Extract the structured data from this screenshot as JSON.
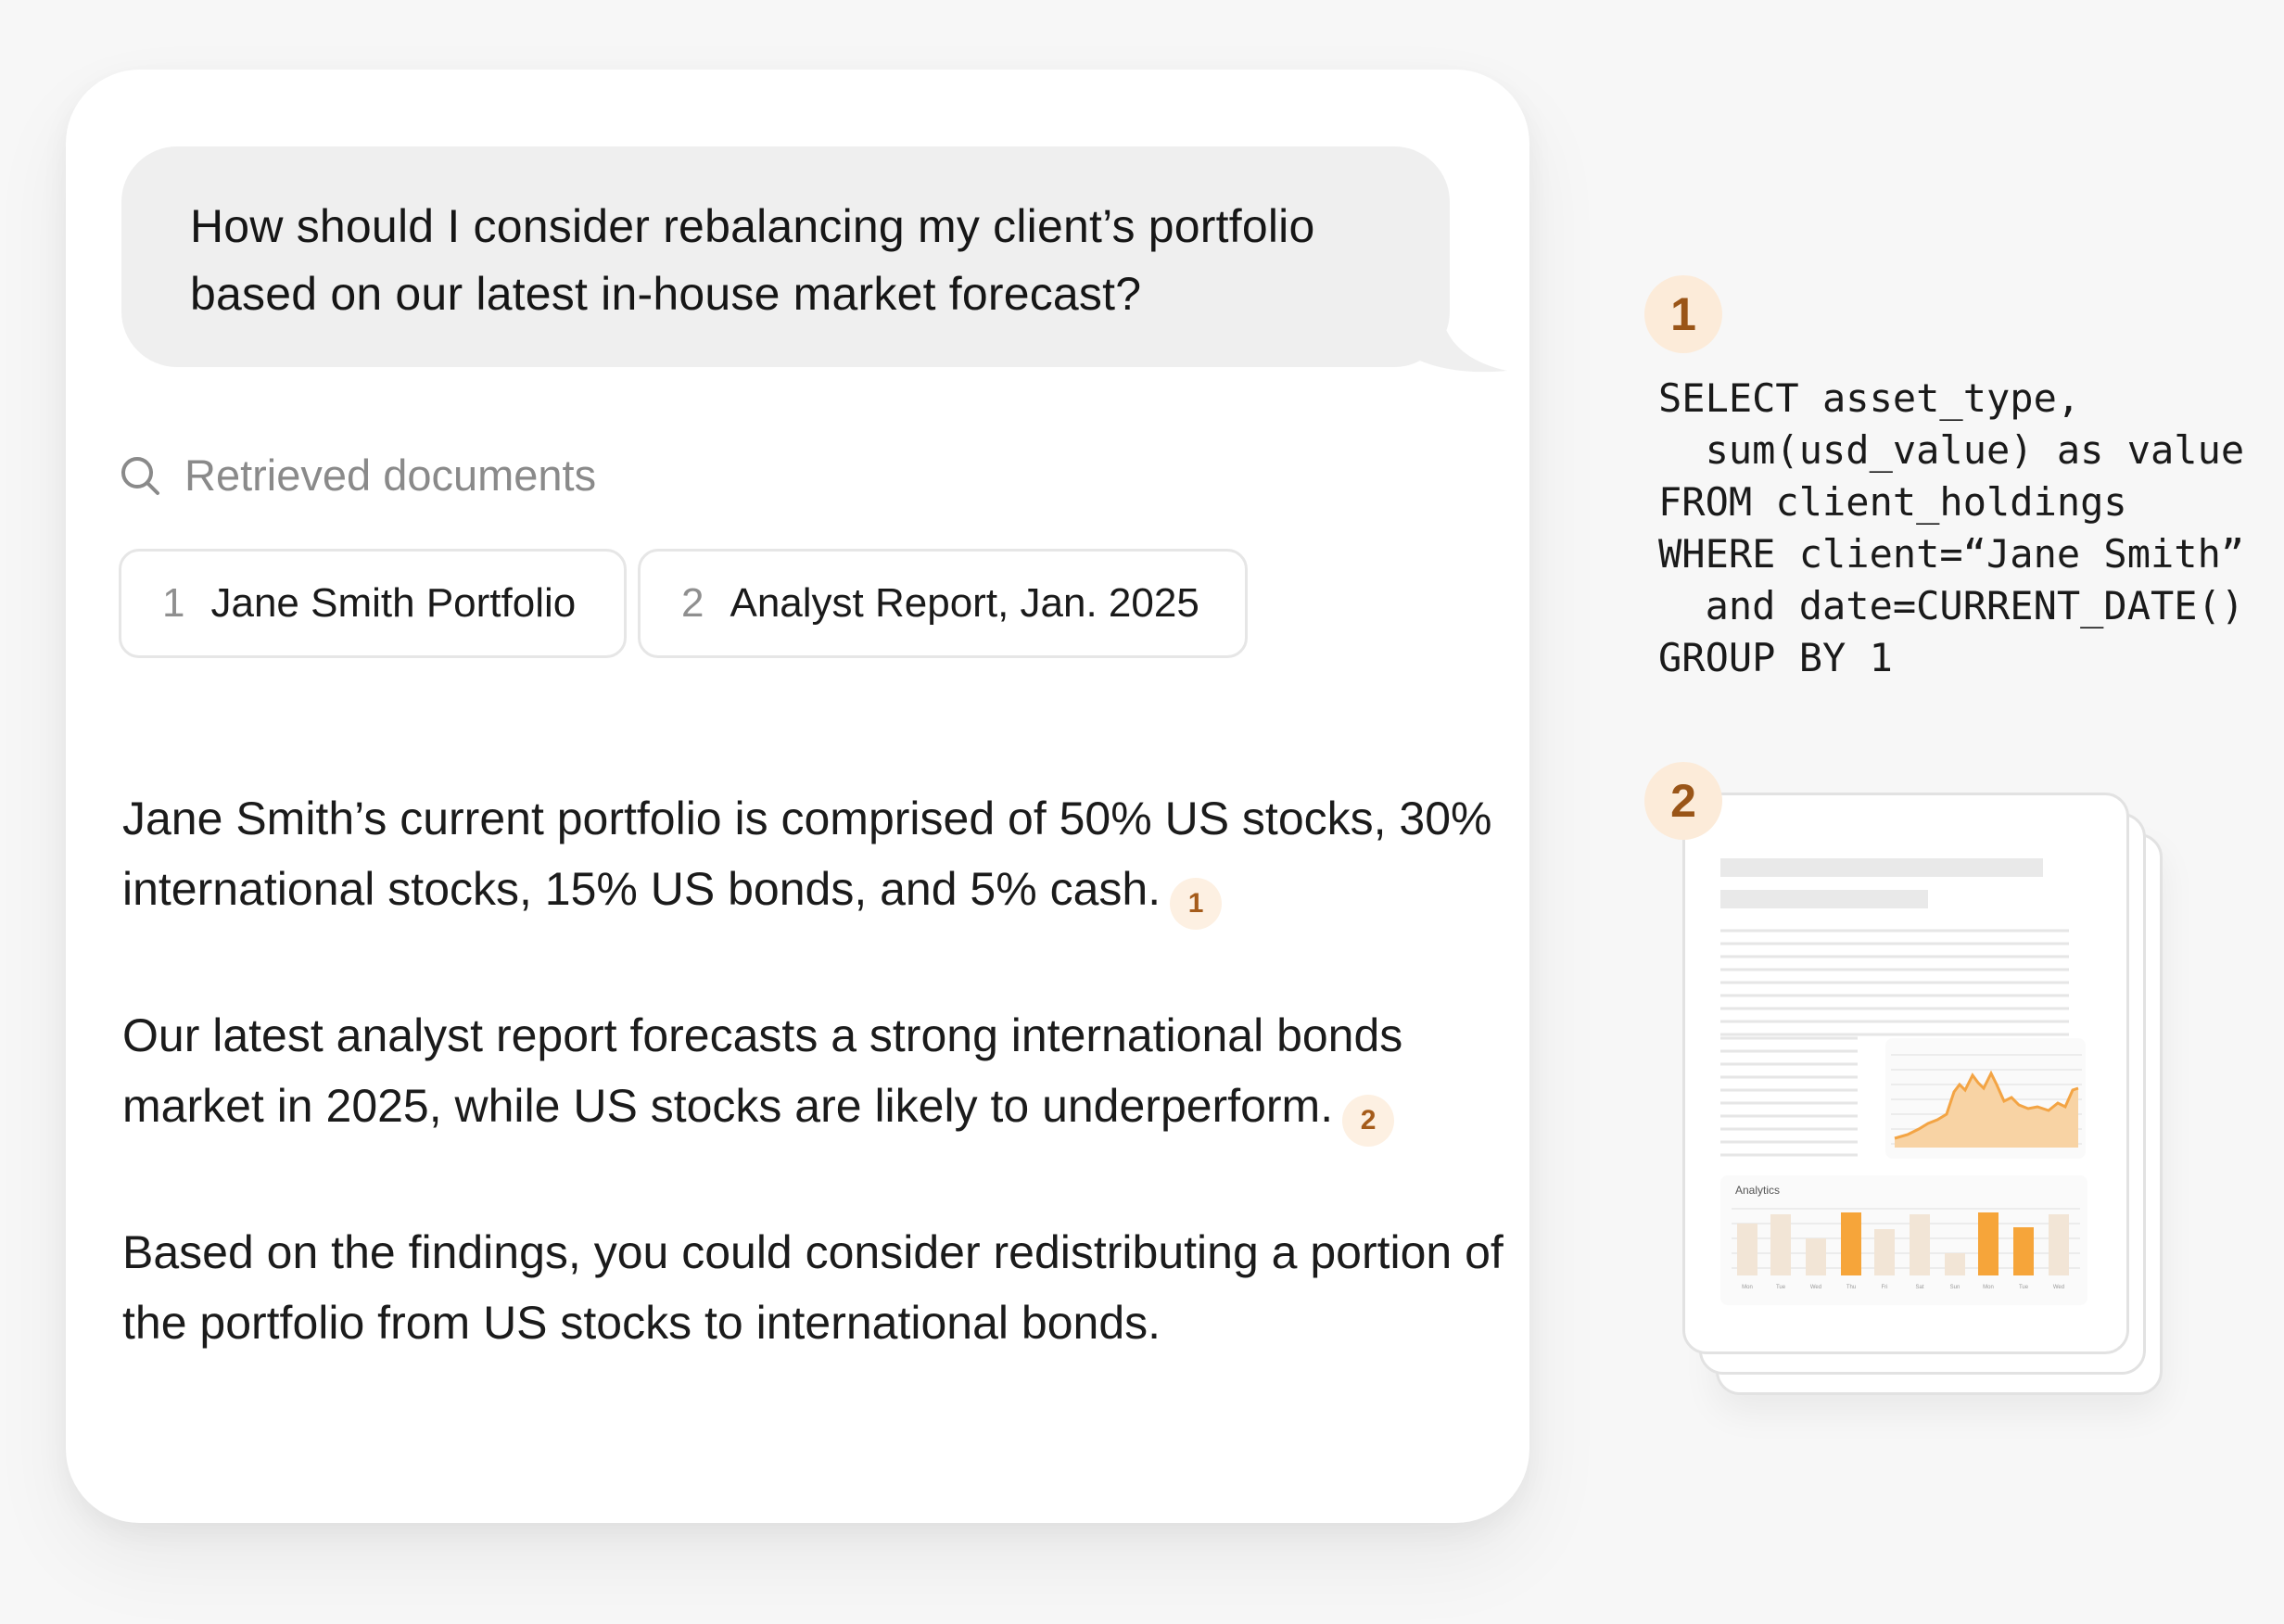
{
  "chat": {
    "question": "How should I consider rebalancing my client’s portfolio based on our latest in-house market forecast?",
    "retrieved_label": "Retrieved documents",
    "documents": [
      {
        "num": "1",
        "title": "Jane Smith Portfolio"
      },
      {
        "num": "2",
        "title": "Analyst Report, Jan. 2025"
      }
    ],
    "answer": {
      "p1": "Jane Smith’s current portfolio is comprised of 50% US stocks, 30% international stocks, 15% US bonds, and 5% cash.",
      "p1_cite": "1",
      "p2": "Our latest analyst report forecasts a strong international bonds market in 2025, while US stocks are likely to underperform.",
      "p2_cite": "2",
      "p3": "Based on the findings, you could consider redistributing a portion of the portfolio from US stocks to international bonds."
    }
  },
  "sources": {
    "badge_1": "1",
    "badge_2": "2",
    "sql_lines": [
      "SELECT asset_type,",
      "  sum(usd_value) as value",
      "FROM client_holdings",
      "WHERE client=“Jane Smith”",
      "  and date=CURRENT_DATE()",
      "GROUP BY 1"
    ],
    "report_thumbnail": {
      "analytics_label": "Analytics",
      "bar_days": [
        "Mon",
        "Tue",
        "Wed",
        "Thu",
        "Fri",
        "Sat",
        "Sun",
        "Mon",
        "Tue",
        "Wed"
      ]
    }
  },
  "colors": {
    "accent": "#f5a33a",
    "accent_soft": "#fcebd9",
    "cite_text": "#a55c1b",
    "bubble_bg": "#efefef"
  }
}
